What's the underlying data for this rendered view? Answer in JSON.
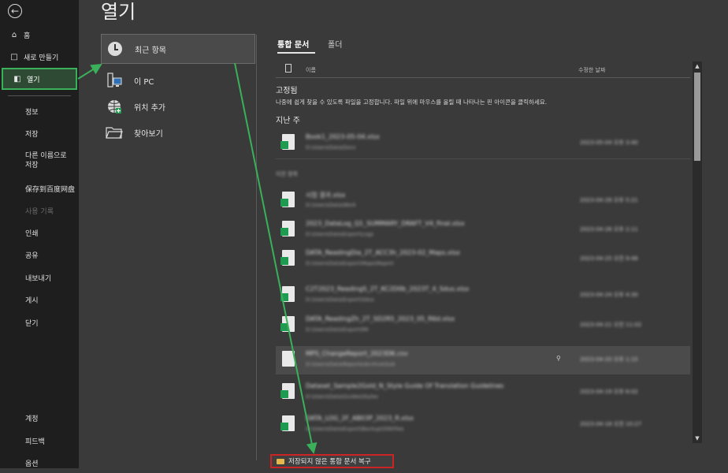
{
  "nav": {
    "back_icon": "arrow-left-circle-icon",
    "items": [
      {
        "label": "홈",
        "icon": "home-icon"
      },
      {
        "label": "새로 만들기",
        "icon": "new-document-icon"
      },
      {
        "label": "열기",
        "icon": "open-folder-icon",
        "active": true
      },
      {
        "label": "정보"
      },
      {
        "label": "저장"
      },
      {
        "label": "다른 이름으로 저장"
      },
      {
        "label": "保存到百度网盘"
      },
      {
        "label": "사용 기록",
        "disabled": true
      },
      {
        "label": "인쇄"
      },
      {
        "label": "공유"
      },
      {
        "label": "내보내기"
      },
      {
        "label": "게시"
      },
      {
        "label": "닫기"
      },
      {
        "label": "계정"
      },
      {
        "label": "피드백"
      },
      {
        "label": "옵션"
      }
    ]
  },
  "title": "열기",
  "locations": [
    {
      "label": "최근 항목",
      "icon": "clock-icon",
      "selected": true
    },
    {
      "label": "이 PC",
      "icon": "pc-icon"
    },
    {
      "label": "위치 추가",
      "icon": "globe-add-icon"
    },
    {
      "label": "찾아보기",
      "icon": "folder-icon"
    }
  ],
  "tabs": [
    {
      "label": "통합 문서",
      "active": true
    },
    {
      "label": "폴더"
    }
  ],
  "list_header": {
    "name": "이름",
    "date": "수정한 날짜"
  },
  "pinned": {
    "title": "고정됨",
    "note": "나중에 쉽게 찾을 수 있도록 파일을 고정합니다. 파일 위에 마우스를 올릴 때 나타나는 핀 아이콘을 클릭하세요."
  },
  "recent_title": "지난 주",
  "group_label": "이전 항목",
  "files": [
    {
      "name": "Book1_2023-05-04.xlsx",
      "path": "D:\\Users\\Data\\Docs",
      "date": "2023-05-04 오후 3:40",
      "icon": "excel-file-icon"
    },
    {
      "name": "시험 결과.xlsx",
      "path": "D:\\Users\\Data\\Work",
      "date": "2023-04-28 오후 5:21",
      "icon": "excel-file-icon"
    },
    {
      "name": "2023_DataLog_Q1_SUMMARY_DRAFT_V4_final.xlsx",
      "path": "D:\\Users\\Data\\Export\\Logs",
      "date": "2023-04-26 오후 2:11",
      "icon": "excel-file-icon"
    },
    {
      "name": "DATA_ReadingDia_2T_ACC3h_2023-02_Maps.xlsx",
      "path": "D:\\Users\\Data\\Export\\Maps\\Report",
      "date": "2023-04-25 오전 9:48",
      "icon": "excel-file-icon"
    },
    {
      "name": "C2T2023_ReadingS_2T_KC2D0b_2023T_4_Sdus.xlsx",
      "path": "D:\\Users\\Data\\Export\\Sdus",
      "date": "2023-04-24 오후 4:30",
      "icon": "excel-file-icon"
    },
    {
      "name": "DATA_ReadingZh_2T_SD2R5_2023_05_R6d.xlsx",
      "path": "D:\\Users\\Data\\Export\\R6",
      "date": "2023-04-21 오전 11:02",
      "icon": "excel-file-icon"
    },
    {
      "name": "MPS_ChangeReport_2023DK.csv",
      "path": "D:\\Users\\Data\\Reports\\Archive\\Sub",
      "date": "2023-04-20 오후 1:15",
      "icon": "csv-file-icon",
      "highlight": true
    },
    {
      "name": "Dataset_Sample2Gold_N_Style Guide Of Translation Guidelines",
      "path": "D:\\Users\\Data\\Guides\\Styles",
      "date": "2023-04-19 오후 6:02",
      "icon": "excel-file-icon"
    },
    {
      "name": "DATA_LOG_2F_AB03P_2023_R.xlsx",
      "path": "D:\\Users\\Data\\Export\\Backup\\Old\\Files",
      "date": "2023-04-18 오전 10:27",
      "icon": "excel-file-icon"
    }
  ],
  "recover_button": {
    "label": "저장되지 않은 통합 문서 복구",
    "icon": "folder-icon"
  },
  "colors": {
    "accent_green": "#3bb05a",
    "annotation_red": "#cc2424",
    "excel_green": "#1f9a51"
  }
}
